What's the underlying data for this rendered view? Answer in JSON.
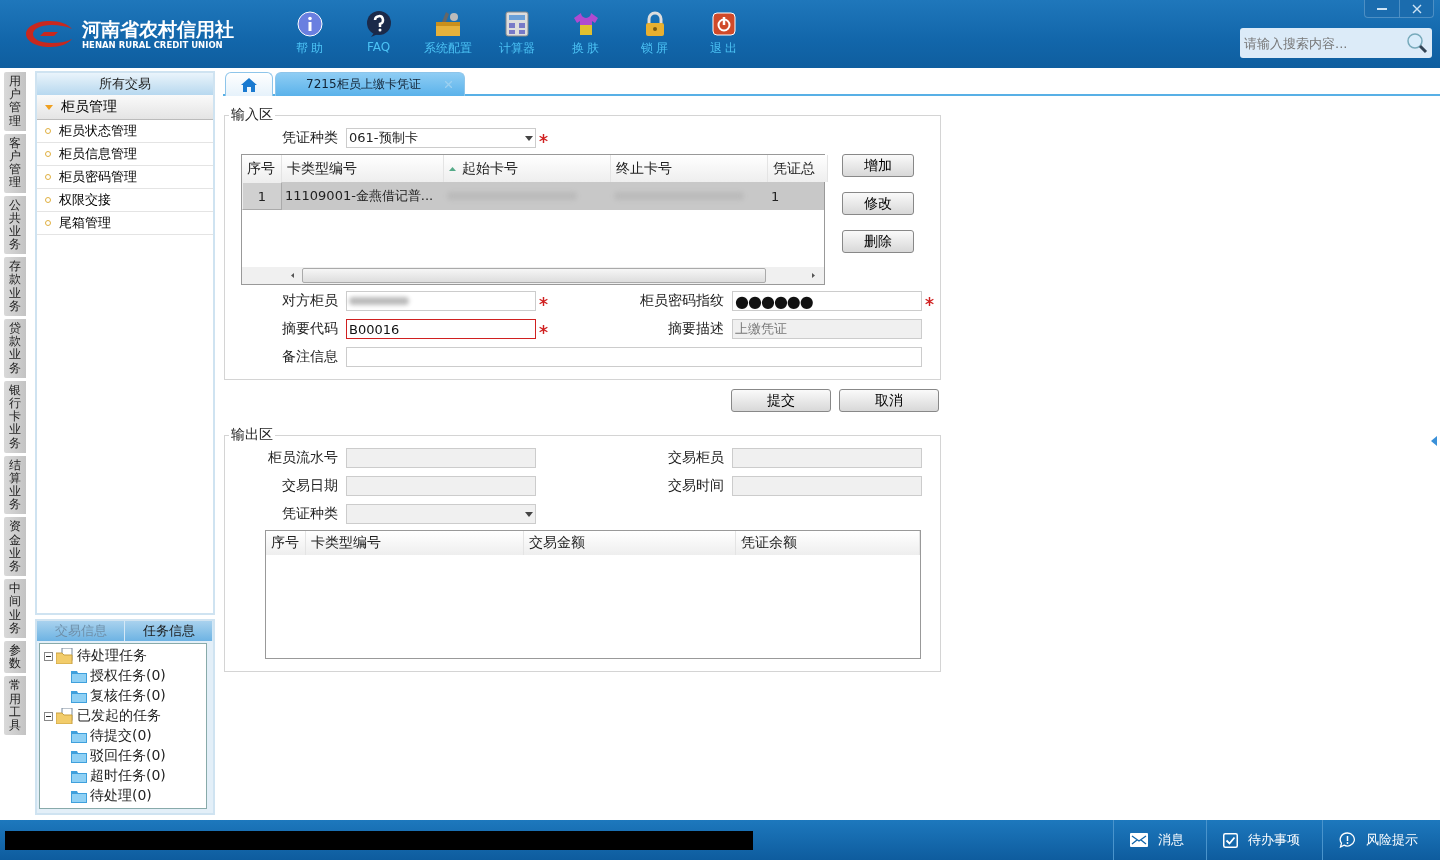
{
  "header": {
    "logo_name": "河南省农村信用社",
    "logo_subtitle": "HENAN RURAL CREDIT UNION",
    "toolbar": [
      {
        "label": "帮 助"
      },
      {
        "label": "FAQ"
      },
      {
        "label": "系统配置"
      },
      {
        "label": "计算器"
      },
      {
        "label": "换 肤"
      },
      {
        "label": "锁 屏"
      },
      {
        "label": "退 出"
      }
    ],
    "search": {
      "placeholder": "请输入搜索内容..."
    }
  },
  "side_tabs": [
    {
      "label": "用户管理"
    },
    {
      "label": "客户管理"
    },
    {
      "label": "公共业务"
    },
    {
      "label": "存款业务"
    },
    {
      "label": "贷款业务"
    },
    {
      "label": "银行卡业务"
    },
    {
      "label": "结算业务"
    },
    {
      "label": "资金业务"
    },
    {
      "label": "中间业务"
    },
    {
      "label": "参数"
    },
    {
      "label": "常用工具"
    }
  ],
  "sidebar": {
    "title": "所有交易",
    "group": {
      "label": "柜员管理",
      "expanded": true,
      "items": [
        {
          "label": "柜员状态管理"
        },
        {
          "label": "柜员信息管理"
        },
        {
          "label": "柜员密码管理"
        },
        {
          "label": "权限交接"
        },
        {
          "label": "尾箱管理"
        }
      ]
    }
  },
  "info_panel": {
    "tabs": [
      {
        "label": "交易信息",
        "selected": false
      },
      {
        "label": "任务信息",
        "selected": true
      }
    ],
    "tree": [
      {
        "label": "待处理任务",
        "expanded": true,
        "children": [
          {
            "label": "授权任务(0)"
          },
          {
            "label": "复核任务(0)"
          }
        ]
      },
      {
        "label": "已发起的任务",
        "expanded": true,
        "children": [
          {
            "label": "待提交(0)"
          },
          {
            "label": "驳回任务(0)"
          },
          {
            "label": "超时任务(0)"
          },
          {
            "label": "待处理(0)"
          }
        ]
      }
    ]
  },
  "tabs": [
    {
      "kind": "home",
      "selected": false
    },
    {
      "kind": "page",
      "label": "7215柜员上缴卡凭证",
      "selected": true
    }
  ],
  "input_section": {
    "title": "输入区",
    "voucher_type": {
      "label": "凭证种类",
      "value": "061-预制卡",
      "required": true
    },
    "grid": {
      "columns": [
        {
          "label": "序号",
          "sorted": false
        },
        {
          "label": "卡类型编号",
          "sorted": false
        },
        {
          "label": "起始卡号",
          "sorted": true
        },
        {
          "label": "终止卡号",
          "sorted": false
        },
        {
          "label": "凭证总",
          "sorted": false
        }
      ],
      "rows": [
        {
          "index": "1",
          "card_type": "11109001-金燕借记普...",
          "start_blurred": true,
          "end_blurred": true,
          "total": "1",
          "selected": true
        }
      ]
    },
    "buttons": [
      {
        "label": "增加"
      },
      {
        "label": "修改"
      },
      {
        "label": "删除"
      }
    ],
    "fields": [
      {
        "kind": "blurred",
        "label": "对方柜员",
        "required": true
      },
      {
        "kind": "password",
        "label": "柜员密码指纹",
        "value": "●●●●●●",
        "required": true
      },
      {
        "kind": "text",
        "label": "摘要代码",
        "value": "B00016",
        "required": true,
        "error": true
      },
      {
        "kind": "readonly",
        "label": "摘要描述",
        "value": "上缴凭证"
      },
      {
        "kind": "text",
        "label": "备注信息",
        "full_width": true
      }
    ],
    "actions": [
      {
        "label": "提交"
      },
      {
        "label": "取消"
      }
    ]
  },
  "output_section": {
    "title": "输出区",
    "fields": [
      {
        "kind": "readonly",
        "label": "柜员流水号"
      },
      {
        "kind": "readonly",
        "label": "交易柜员"
      },
      {
        "kind": "readonly",
        "label": "交易日期"
      },
      {
        "kind": "readonly",
        "label": "交易时间"
      },
      {
        "kind": "select",
        "label": "凭证种类"
      }
    ],
    "columns": [
      "序号",
      "卡类型编号",
      "交易金额",
      "凭证余额"
    ]
  },
  "status_bar": {
    "redacted": true,
    "items": [
      {
        "label": "消息"
      },
      {
        "label": "待办事项"
      },
      {
        "label": "风险提示"
      }
    ]
  }
}
